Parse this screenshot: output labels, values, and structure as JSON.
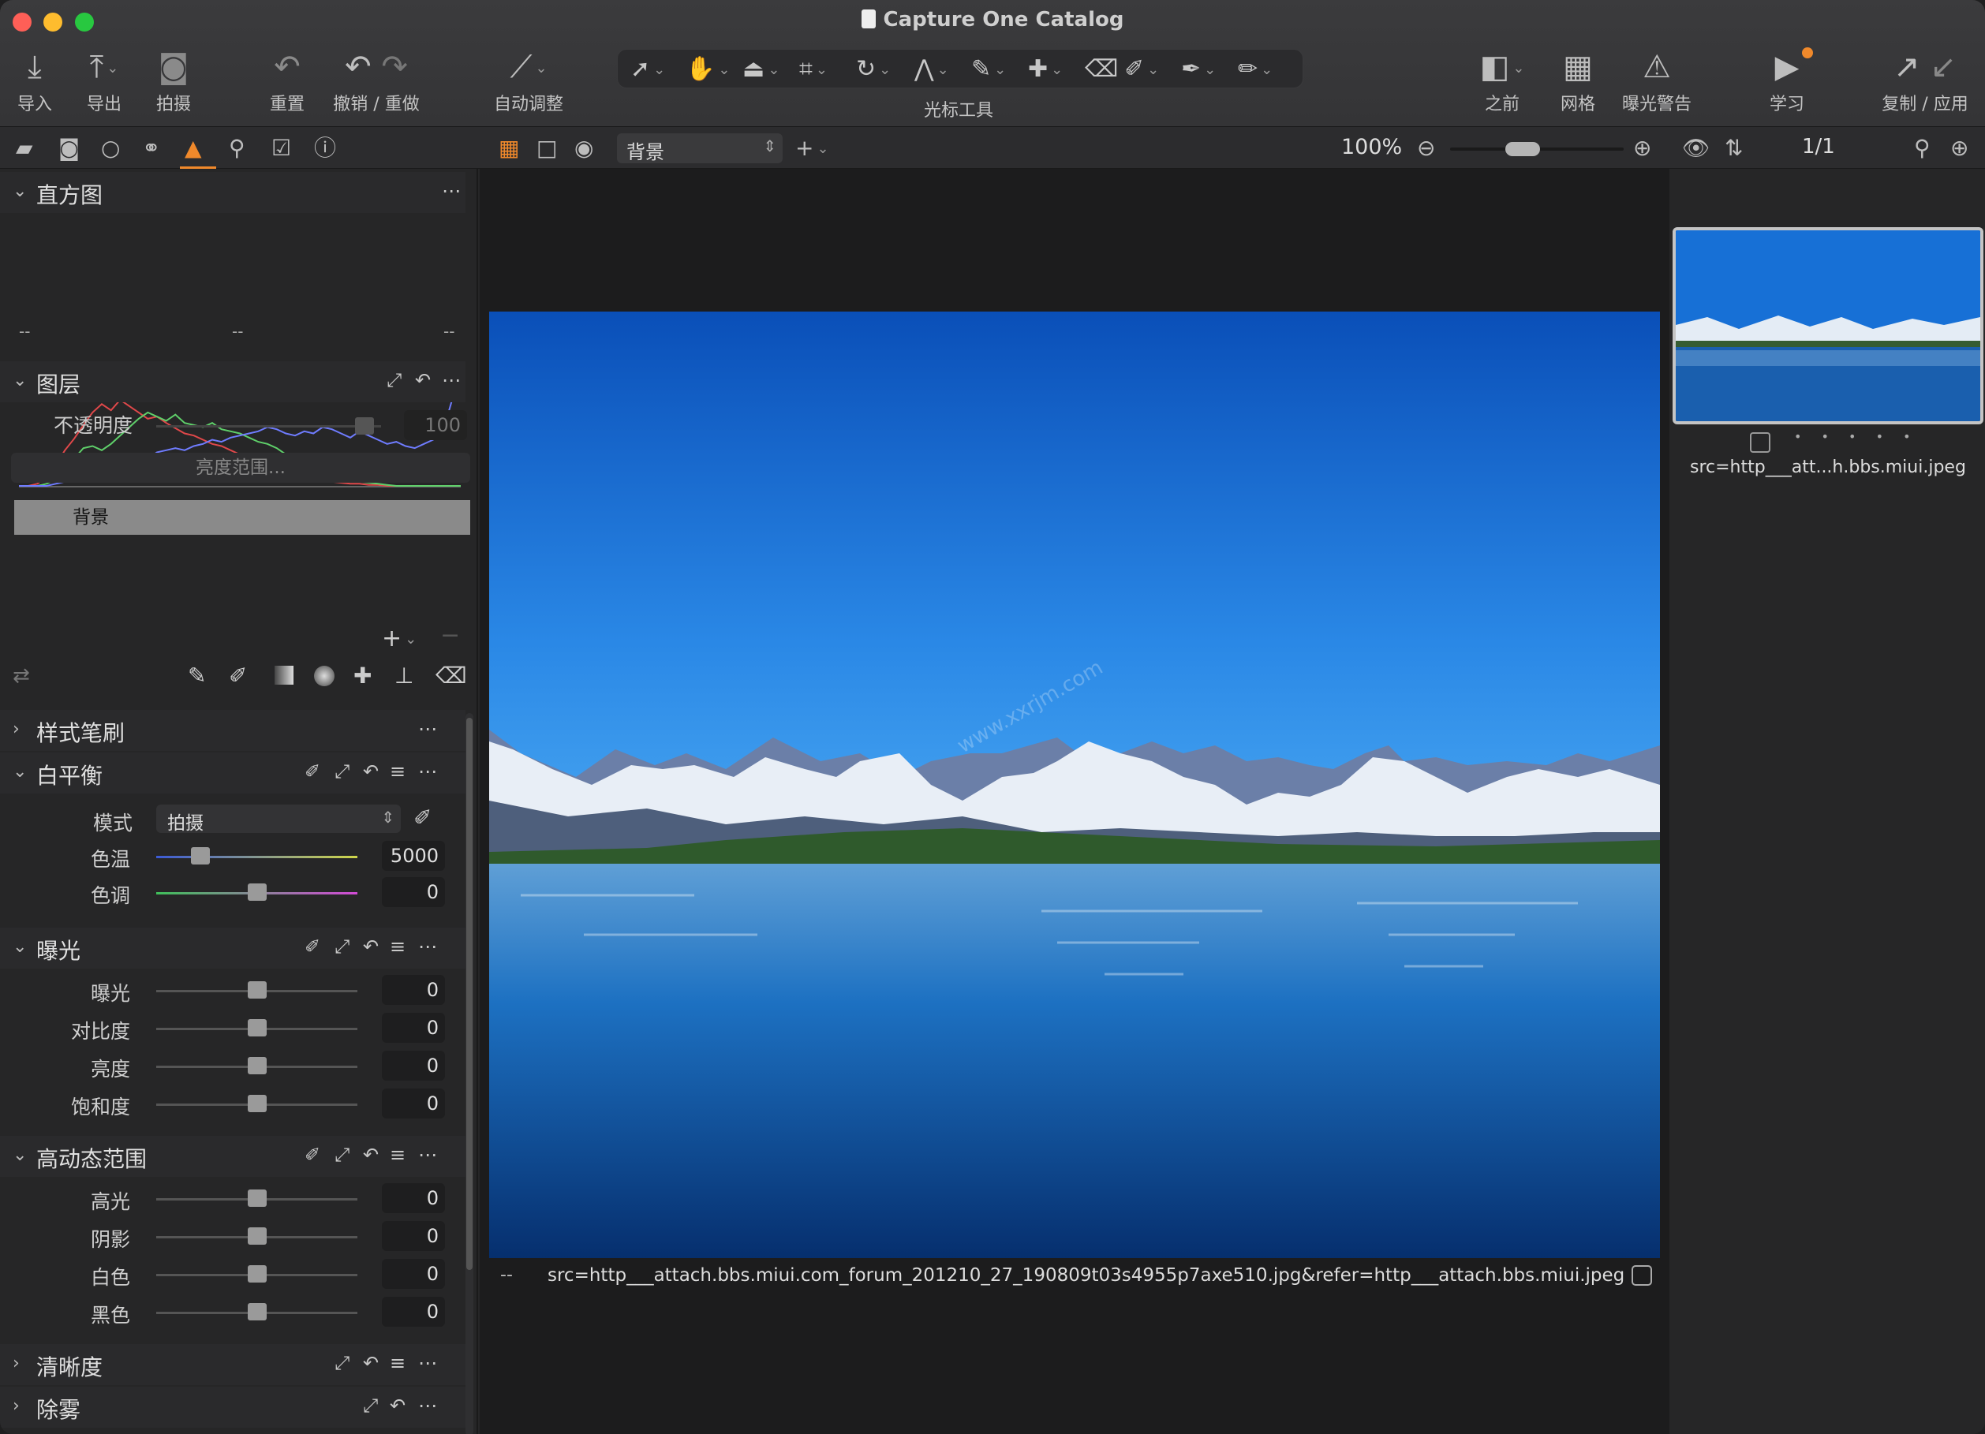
{
  "window": {
    "title": "Capture One Catalog"
  },
  "toolbar": {
    "import": "导入",
    "export": "导出",
    "capture": "拍摄",
    "reset": "重置",
    "undo_redo": "撤销 / 重做",
    "auto_adjust": "自动调整",
    "cursor_tools": "光标工具",
    "before": "之前",
    "grid": "网格",
    "exposure_warning": "曝光警告",
    "learn": "学习",
    "copy_apply": "复制 / 应用"
  },
  "viewer_bar": {
    "layer_select": "背景",
    "zoom": "100%",
    "count": "1/1"
  },
  "histogram": {
    "title": "直方图",
    "ticks": [
      "--",
      "--",
      "--"
    ],
    "red": [
      0,
      0,
      2,
      8,
      20,
      34,
      45,
      58,
      70,
      78,
      72,
      82,
      76,
      70,
      64,
      66,
      60,
      55,
      50,
      48,
      44,
      40,
      38,
      34,
      30,
      26,
      22,
      18,
      15,
      12,
      10,
      8,
      6,
      5,
      4,
      3,
      2,
      2,
      1,
      1,
      0,
      0,
      0,
      0,
      0,
      0,
      0,
      0,
      0
    ],
    "green": [
      0,
      0,
      0,
      2,
      6,
      14,
      26,
      36,
      38,
      34,
      40,
      48,
      56,
      64,
      70,
      66,
      62,
      68,
      60,
      58,
      56,
      60,
      54,
      52,
      50,
      46,
      42,
      40,
      36,
      30,
      26,
      22,
      18,
      14,
      10,
      8,
      6,
      4,
      3,
      2,
      1,
      0,
      0,
      0,
      0,
      0,
      0,
      0,
      0
    ],
    "blue": [
      0,
      0,
      0,
      0,
      2,
      4,
      8,
      12,
      16,
      18,
      16,
      14,
      18,
      20,
      26,
      32,
      34,
      36,
      34,
      38,
      40,
      44,
      42,
      46,
      48,
      50,
      52,
      56,
      54,
      50,
      48,
      52,
      50,
      56,
      54,
      50,
      46,
      52,
      48,
      44,
      40,
      42,
      38,
      36,
      40,
      44,
      50,
      80,
      100
    ]
  },
  "layers": {
    "title": "图层",
    "opacity_label": "不透明度",
    "opacity_value": "100",
    "opacity": 0.97,
    "luma_range": "亮度范围...",
    "layer_name": "背景"
  },
  "styles_brushes": {
    "title": "样式笔刷"
  },
  "white_balance": {
    "title": "白平衡",
    "mode_label": "模式",
    "mode_value": "拍摄",
    "rows": [
      {
        "label": "色温",
        "value": "5000",
        "pos": 0.22
      },
      {
        "label": "色调",
        "value": "0",
        "pos": 0.5
      }
    ]
  },
  "exposure": {
    "title": "曝光",
    "rows": [
      {
        "label": "曝光",
        "value": "0",
        "pos": 0.5
      },
      {
        "label": "对比度",
        "value": "0",
        "pos": 0.5
      },
      {
        "label": "亮度",
        "value": "0",
        "pos": 0.5
      },
      {
        "label": "饱和度",
        "value": "0",
        "pos": 0.5
      }
    ]
  },
  "hdr": {
    "title": "高动态范围",
    "rows": [
      {
        "label": "高光",
        "value": "0",
        "pos": 0.5
      },
      {
        "label": "阴影",
        "value": "0",
        "pos": 0.5
      },
      {
        "label": "白色",
        "value": "0",
        "pos": 0.5
      },
      {
        "label": "黑色",
        "value": "0",
        "pos": 0.5
      }
    ]
  },
  "clarity": {
    "title": "清晰度"
  },
  "dehaze": {
    "title": "除雾"
  },
  "viewer": {
    "rating": "--",
    "filename": "src=http___attach.bbs.miui.com_forum_201210_27_190809t03s4955p7axe510.jpg&refer=http___attach.bbs.miui.jpeg",
    "watermark": "www.xxrjm.com"
  },
  "browser": {
    "thumb_name": "src=http___att...h.bbs.miui.jpeg",
    "dots": "• • • • •"
  },
  "colors": {
    "accent": "#f0892b",
    "bg": "#262627",
    "panel": "#2a2a2c"
  },
  "icons": [
    "download-icon",
    "upload-icon",
    "camera-icon",
    "reset-icon",
    "undo-icon",
    "redo-icon",
    "magic-wand-icon",
    "arrow-cursor-icon",
    "hand-icon",
    "crop-icon",
    "rotate-icon",
    "brush-icon",
    "eraser-icon",
    "eyedropper-icon",
    "compare-icon",
    "grid-icon",
    "warning-icon",
    "play-icon",
    "copy-icon",
    "apply-icon"
  ]
}
